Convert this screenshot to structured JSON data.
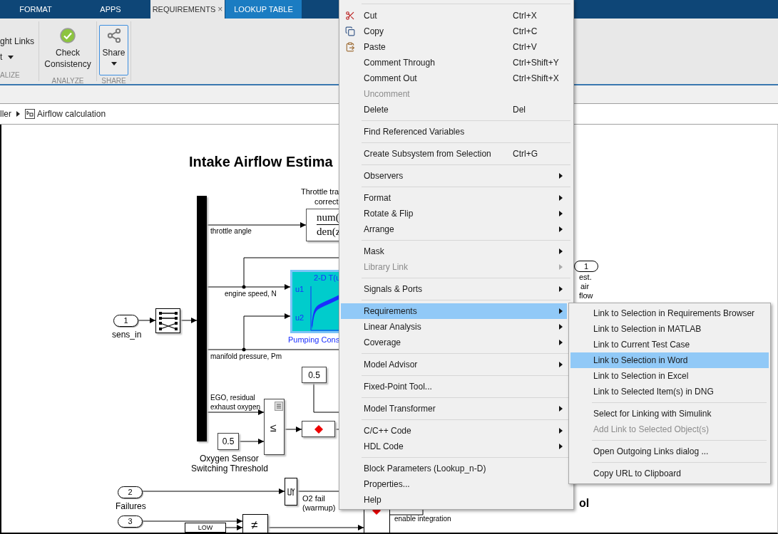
{
  "tabs": [
    {
      "label": "FORMAT",
      "selected": false,
      "kind": "normal"
    },
    {
      "label": "APPS",
      "selected": false,
      "kind": "normal"
    },
    {
      "label": "REQUIREMENTS",
      "selected": true,
      "kind": "normal",
      "close": "×"
    },
    {
      "label": "LOOKUP TABLE",
      "selected": false,
      "kind": "contextual"
    }
  ],
  "ribbon": {
    "sections": [
      {
        "kind": "links",
        "title": "ALIZE",
        "items": [
          {
            "label": "ght Links",
            "dropdown": false
          },
          {
            "label": "t",
            "dropdown": true
          }
        ]
      },
      {
        "kind": "check",
        "title": "ANALYZE",
        "button": {
          "lines": [
            "Check",
            "Consistency"
          ],
          "selected": false,
          "dropdown": false
        }
      },
      {
        "kind": "share",
        "title": "SHARE",
        "button": {
          "lines": [
            "Share"
          ],
          "selected": true,
          "dropdown": true
        }
      }
    ]
  },
  "breadcrumb": [
    {
      "label": "ller",
      "kind": "text"
    },
    {
      "label": "Airflow calculation",
      "kind": "subsystem"
    }
  ],
  "diagram": {
    "title": "Intake Airflow Estima",
    "throttle_label": [
      "Throttle tra",
      "correct"
    ],
    "transfer_fcn": {
      "num": "num(",
      "den": "den(z"
    },
    "signals": [
      "throttle angle",
      "engine speed, N",
      "manifold pressure, Pm"
    ],
    "ego_label": [
      "EGO, residual",
      "exhaust oxygen"
    ],
    "lookup": {
      "title": "2-D T(u",
      "in1": "u1",
      "in2": "u2",
      "name": "Pumping Cons"
    },
    "constants": [
      "0.5",
      "0.5"
    ],
    "threshold_label": [
      "Oxygen Sensor",
      "Switching Threshold"
    ],
    "compare_op": "≤",
    "inports": [
      {
        "number": "1",
        "name": "sens_in"
      },
      {
        "number": "2",
        "name": "Failures"
      },
      {
        "number": "3"
      }
    ],
    "o2_fail": [
      "O2 fail",
      "(warmup)"
    ],
    "not_equal": "≠",
    "low": "LOW",
    "enable": "enable integration",
    "outport": {
      "number": "1",
      "name": [
        "est.",
        "air",
        "flow"
      ]
    },
    "subtitle": "ol"
  },
  "context_menu": {
    "groups": [
      {
        "items": [
          {
            "label": "Cut",
            "shortcut": "Ctrl+X",
            "has_submenu": false,
            "disabled": false,
            "selected": false
          },
          {
            "label": "Copy",
            "shortcut": "Ctrl+C",
            "has_submenu": false,
            "disabled": false,
            "selected": false
          },
          {
            "label": "Paste",
            "shortcut": "Ctrl+V",
            "has_submenu": false,
            "disabled": false,
            "selected": false
          },
          {
            "label": "Comment Through",
            "shortcut": "Ctrl+Shift+Y",
            "has_submenu": false,
            "disabled": false,
            "selected": false
          },
          {
            "label": "Comment Out",
            "shortcut": "Ctrl+Shift+X",
            "has_submenu": false,
            "disabled": false,
            "selected": false
          },
          {
            "label": "Uncomment",
            "has_submenu": false,
            "disabled": true,
            "selected": false
          },
          {
            "label": "Delete",
            "shortcut": "Del",
            "has_submenu": false,
            "disabled": false,
            "selected": false
          }
        ]
      },
      {
        "items": [
          {
            "label": "Find Referenced Variables",
            "has_submenu": false,
            "disabled": false,
            "selected": false
          }
        ]
      },
      {
        "items": [
          {
            "label": "Create Subsystem from Selection",
            "shortcut": "Ctrl+G",
            "has_submenu": false,
            "disabled": false,
            "selected": false
          }
        ]
      },
      {
        "items": [
          {
            "label": "Observers",
            "has_submenu": true,
            "disabled": false,
            "selected": false
          }
        ]
      },
      {
        "items": [
          {
            "label": "Format",
            "has_submenu": true,
            "disabled": false,
            "selected": false
          },
          {
            "label": "Rotate & Flip",
            "has_submenu": true,
            "disabled": false,
            "selected": false
          },
          {
            "label": "Arrange",
            "has_submenu": true,
            "disabled": false,
            "selected": false
          }
        ]
      },
      {
        "items": [
          {
            "label": "Mask",
            "has_submenu": true,
            "disabled": false,
            "selected": false
          },
          {
            "label": "Library Link",
            "has_submenu": true,
            "disabled": true,
            "selected": false
          }
        ]
      },
      {
        "items": [
          {
            "label": "Signals & Ports",
            "has_submenu": true,
            "disabled": false,
            "selected": false
          }
        ]
      },
      {
        "items": [
          {
            "label": "Requirements",
            "has_submenu": true,
            "disabled": false,
            "selected": true
          },
          {
            "label": "Linear Analysis",
            "has_submenu": true,
            "disabled": false,
            "selected": false
          },
          {
            "label": "Coverage",
            "has_submenu": true,
            "disabled": false,
            "selected": false
          }
        ]
      },
      {
        "items": [
          {
            "label": "Model Advisor",
            "has_submenu": true,
            "disabled": false,
            "selected": false
          }
        ]
      },
      {
        "items": [
          {
            "label": "Fixed-Point Tool...",
            "has_submenu": false,
            "disabled": false,
            "selected": false
          }
        ]
      },
      {
        "items": [
          {
            "label": "Model Transformer",
            "has_submenu": true,
            "disabled": false,
            "selected": false
          }
        ]
      },
      {
        "items": [
          {
            "label": "C/C++ Code",
            "has_submenu": true,
            "disabled": false,
            "selected": false
          },
          {
            "label": "HDL Code",
            "has_submenu": true,
            "disabled": false,
            "selected": false
          }
        ]
      },
      {
        "items": [
          {
            "label": "Block Parameters (Lookup_n-D)",
            "has_submenu": false,
            "disabled": false,
            "selected": false
          },
          {
            "label": "Properties...",
            "has_submenu": false,
            "disabled": false,
            "selected": false
          },
          {
            "label": "Help",
            "has_submenu": false,
            "disabled": false,
            "selected": false
          }
        ]
      }
    ]
  },
  "submenu": {
    "groups": [
      {
        "items": [
          {
            "label": "Link to Selection in Requirements Browser",
            "disabled": false,
            "selected": false
          },
          {
            "label": "Link to Selection in MATLAB",
            "disabled": false,
            "selected": false
          },
          {
            "label": "Link to Current Test Case",
            "disabled": false,
            "selected": false
          },
          {
            "label": "Link to Selection in Word",
            "disabled": false,
            "selected": true
          },
          {
            "label": "Link to Selection in Excel",
            "disabled": false,
            "selected": false
          },
          {
            "label": "Link to Selected Item(s) in DNG",
            "disabled": false,
            "selected": false
          }
        ]
      },
      {
        "items": [
          {
            "label": "Select for Linking with Simulink",
            "disabled": false,
            "selected": false
          },
          {
            "label": "Add Link to Selected Object(s)",
            "disabled": true,
            "selected": false
          }
        ]
      },
      {
        "items": [
          {
            "label": "Open Outgoing Links dialog ...",
            "disabled": false,
            "selected": false
          }
        ]
      },
      {
        "items": [
          {
            "label": "Copy URL to Clipboard",
            "disabled": false,
            "selected": false
          }
        ]
      }
    ]
  }
}
